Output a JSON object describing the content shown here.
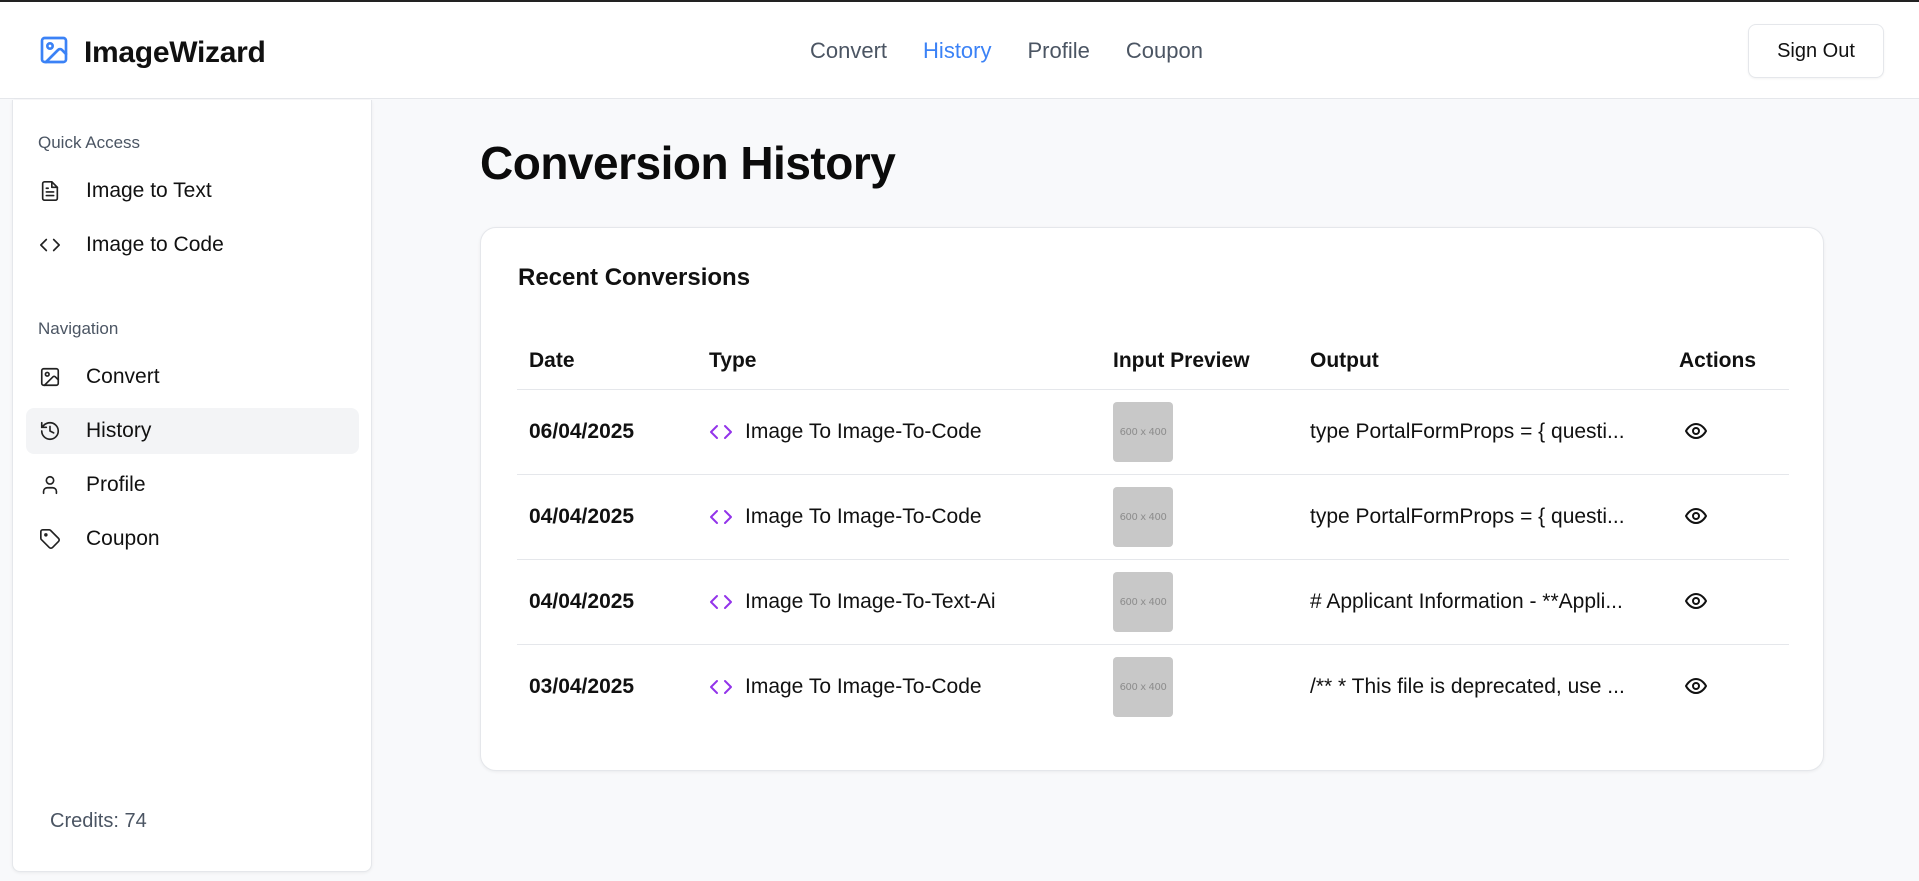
{
  "header": {
    "brand": "ImageWizard",
    "nav": [
      {
        "label": "Convert",
        "active": false
      },
      {
        "label": "History",
        "active": true
      },
      {
        "label": "Profile",
        "active": false
      },
      {
        "label": "Coupon",
        "active": false
      }
    ],
    "sign_out_label": "Sign Out"
  },
  "sidebar": {
    "quick_access_title": "Quick Access",
    "quick_access": [
      {
        "label": "Image to Text",
        "icon": "file-text-icon"
      },
      {
        "label": "Image to Code",
        "icon": "code-icon"
      }
    ],
    "navigation_title": "Navigation",
    "navigation": [
      {
        "label": "Convert",
        "icon": "image-icon"
      },
      {
        "label": "History",
        "icon": "history-icon"
      },
      {
        "label": "Profile",
        "icon": "user-icon"
      },
      {
        "label": "Coupon",
        "icon": "tag-icon"
      }
    ],
    "credits": "Credits: 74"
  },
  "main": {
    "page_title": "Conversion History",
    "card_title": "Recent Conversions",
    "columns": [
      "Date",
      "Type",
      "Input Preview",
      "Output",
      "Actions"
    ],
    "rows": [
      {
        "date": "06/04/2025",
        "type": "Image To Image-To-Code",
        "preview": "600 x 400",
        "output": "type PortalFormProps = { questi..."
      },
      {
        "date": "04/04/2025",
        "type": "Image To Image-To-Code",
        "preview": "600 x 400",
        "output": "type PortalFormProps = { questi..."
      },
      {
        "date": "04/04/2025",
        "type": "Image To Image-To-Text-Ai",
        "preview": "600 x 400",
        "output": "# Applicant Information - **Appli..."
      },
      {
        "date": "03/04/2025",
        "type": "Image To Image-To-Code",
        "preview": "600 x 400",
        "output": "/** * This file is deprecated, use ..."
      }
    ]
  },
  "colors": {
    "accent": "#3b82f6",
    "type_icon": "#9333ea",
    "thumb": "#c8c8c8",
    "active_bg": "#f3f4f6"
  }
}
